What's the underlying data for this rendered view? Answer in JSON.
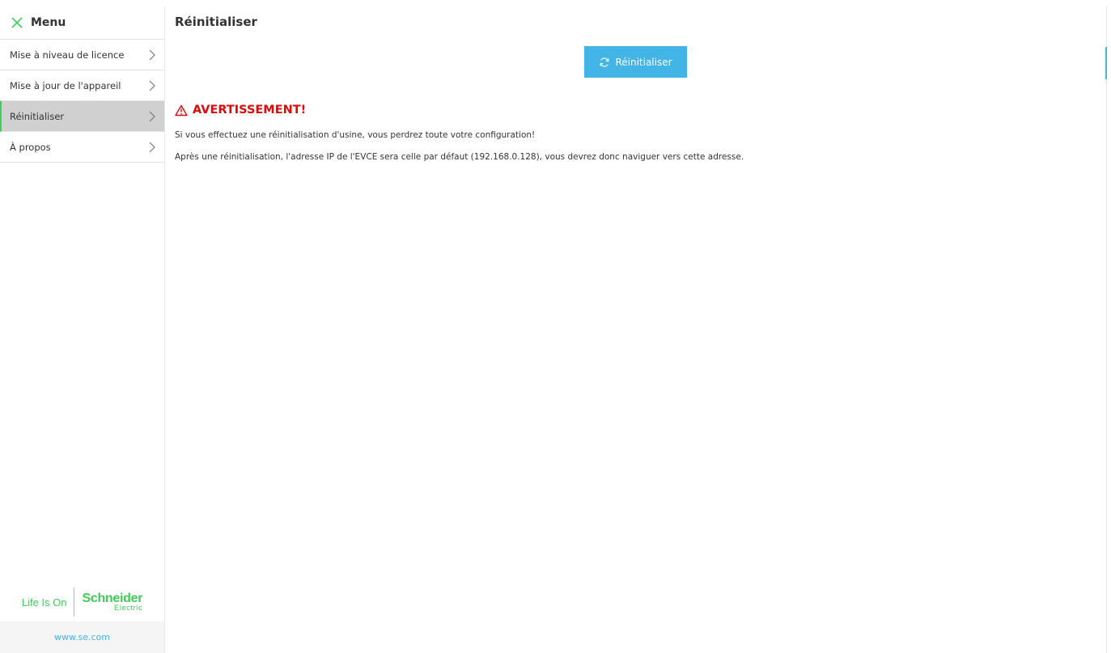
{
  "sidebar": {
    "menu_label": "Menu",
    "items": [
      {
        "label": "Mise à niveau de licence"
      },
      {
        "label": "Mise à jour de l'appareil"
      },
      {
        "label": "Réinitialiser"
      },
      {
        "label": "À propos"
      }
    ],
    "active_index": 2,
    "logo": {
      "tagline": "Life Is On",
      "brand": "Schneider",
      "brand_sub": "Electric"
    },
    "footer_link": "www.se.com"
  },
  "main": {
    "title": "Réinitialiser",
    "reset_button_label": "Réinitialiser",
    "warning": {
      "title": "AVERTISSEMENT!",
      "line1": "Si vous effectuez une réinitialisation d'usine, vous perdrez toute votre configuration!",
      "line2": "Après une réinitialisation, l'adresse IP de l'EVCE sera celle par défaut (192.168.0.128), vous devrez donc naviguer vers cette adresse."
    }
  },
  "icons": {
    "close": "close-icon",
    "chevron": "chevron-right-icon",
    "refresh": "refresh-icon",
    "warning": "warning-icon"
  },
  "colors": {
    "accent_green": "#3dcd58",
    "button_blue": "#42b4e6",
    "warning_red": "#dc0a0a",
    "active_item_bg": "#d0d0d0"
  }
}
